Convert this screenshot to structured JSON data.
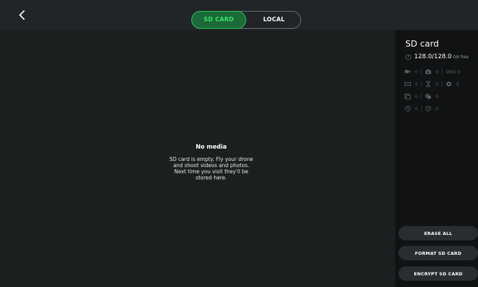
{
  "header": {
    "tabs": [
      {
        "label": "SD CARD",
        "active": true
      },
      {
        "label": "LOCAL",
        "active": false
      }
    ],
    "accent_color": "#21c75a"
  },
  "main": {
    "empty_title": "No media",
    "empty_lines": [
      "SD card is empty. Fly your drone",
      "and shoot videos and photos.",
      "Next time you visit they'll be",
      "stored here."
    ]
  },
  "sidebar": {
    "title": "SD card",
    "storage": {
      "value": "128.0/128.0",
      "unit": "GB free"
    },
    "stats": {
      "videos": "0",
      "photos": "0",
      "dng_label": "DNG",
      "dng": "0",
      "panorama": "0",
      "timelapse": "0",
      "spherical": "0",
      "burst": "0",
      "bracketing": "0",
      "gps_lapse": "0",
      "timer": "0"
    },
    "buttons": {
      "erase_all": "ERASE ALL",
      "format": "FORMAT SD CARD",
      "encrypt": "ENCRYPT SD CARD"
    }
  }
}
